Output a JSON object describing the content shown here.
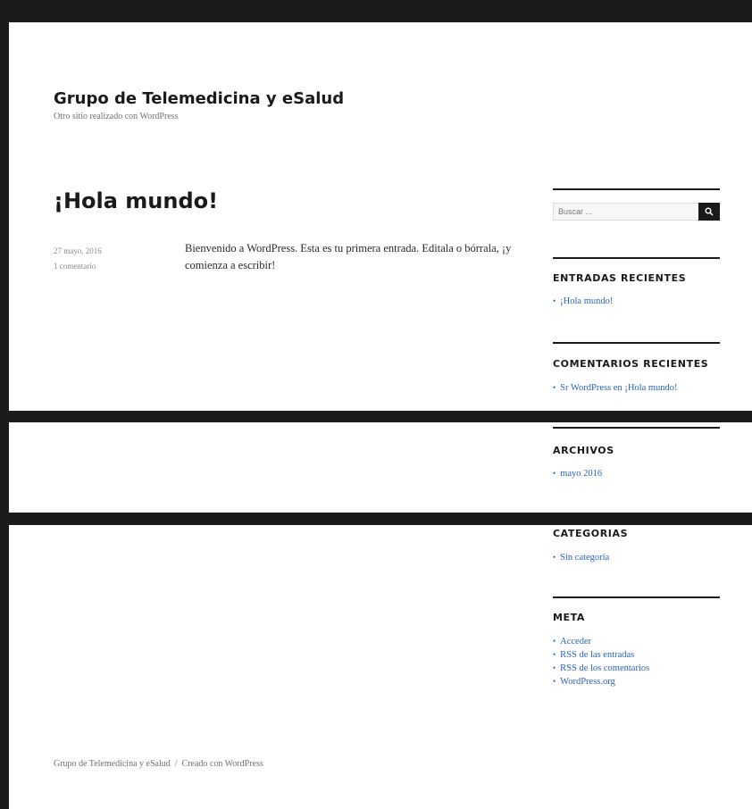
{
  "site": {
    "title": "Grupo de Telemedicina y eSalud",
    "description": "Otro sitio realizado con WordPress"
  },
  "post": {
    "title": "¡Hola mundo!",
    "date": "27 mayo, 2016",
    "comments": "1 comentario",
    "content": "Bienvenido a WordPress. Esta es tu primera entrada. Editala o bórrala, ¡y comienza a escribir!"
  },
  "sidebar": {
    "search": {
      "placeholder": "Buscar ..."
    },
    "recent_posts": {
      "title": "ENTRADAS RECIENTES",
      "items": [
        "¡Hola mundo!"
      ]
    },
    "recent_comments": {
      "title": "COMENTARIOS RECIENTES",
      "items": [
        "Sr WordPress en ¡Hola mundo!"
      ]
    },
    "archives": {
      "title": "ARCHIVOS",
      "items": [
        "mayo 2016"
      ]
    },
    "categories": {
      "title": "CATEGORIAS",
      "items": [
        "Sin categoría"
      ]
    },
    "meta": {
      "title": "META",
      "items": [
        "Acceder",
        "RSS de las entradas",
        "RSS de los comentarios",
        "WordPress.org"
      ]
    }
  },
  "footer": {
    "site_link": "Grupo de Telemedicina y eSalud",
    "separator": "/",
    "credit": "Creado con WordPress"
  },
  "colors": {
    "link": "#2a62b8",
    "text": "#1a1a1a",
    "frame": "#1b1b1b"
  },
  "icons": {
    "search_button": "search-icon"
  }
}
